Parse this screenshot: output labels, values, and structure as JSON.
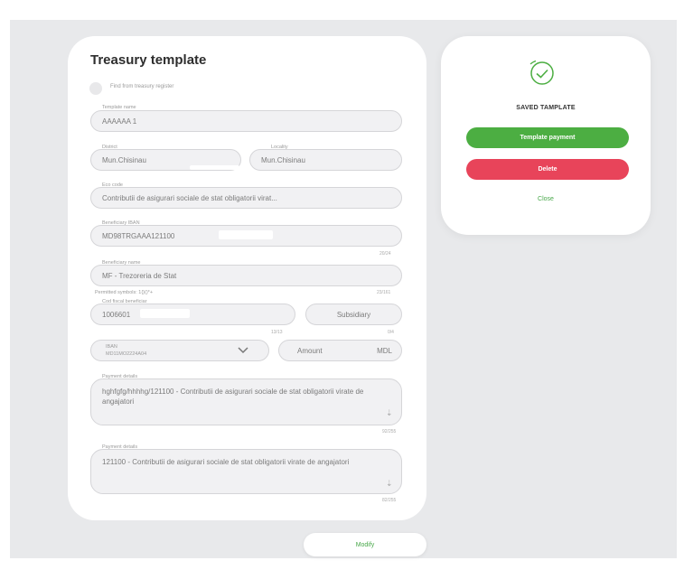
{
  "form": {
    "title": "Treasury template",
    "toggle_label": "Find from treasury register",
    "template_name": {
      "label": "Template name",
      "value": "AAAAAA 1"
    },
    "district": {
      "label": "District",
      "value": "Mun.Chisinau"
    },
    "locality": {
      "label": "Locality",
      "value": "Mun.Chisinau"
    },
    "eco_code": {
      "label": "Eco code",
      "value": "Contributii de asigurari sociale de stat obligatorii virat..."
    },
    "beneficiary_iban": {
      "label": "Beneficiary IBAN",
      "value": "MD98TRGAAA121100",
      "counter": "20/24"
    },
    "beneficiary_name": {
      "label": "Beneficiary name",
      "value": "MF - Trezoreria de Stat",
      "hint": "Permitted symbols: 1{}()*+",
      "counter": "23/161"
    },
    "fiscal_code": {
      "label": "Cod fiscal beneficiar",
      "value": "1006601",
      "counter": "13/13"
    },
    "subsidiary": {
      "value": "Subsidiary",
      "counter": "0/4"
    },
    "iban_select": {
      "label": "IBAN",
      "value": "MD11MO2224A04"
    },
    "amount": {
      "placeholder": "Amount",
      "currency": "MDL"
    },
    "payment_details_1": {
      "label": "Payment details",
      "value": "hghfgfg/hhhhg/121100 - Contributii de asigurari sociale de stat obligatorii virate de angajatori",
      "counter": "92/255"
    },
    "payment_details_2": {
      "label": "Payment details",
      "value": "121100 - Contributii de asigurari sociale de stat obligatorii virate de angajatori",
      "counter": "82/255"
    }
  },
  "side": {
    "icon": "check-circle-icon",
    "saved_label": "SAVED TAMPLATE",
    "template_payment": "Template payment",
    "delete": "Delete",
    "close": "Close"
  },
  "footer": {
    "modify": "Modify"
  },
  "colors": {
    "green": "#4cae42",
    "red": "#e8445a",
    "background": "#e8e9eb"
  }
}
